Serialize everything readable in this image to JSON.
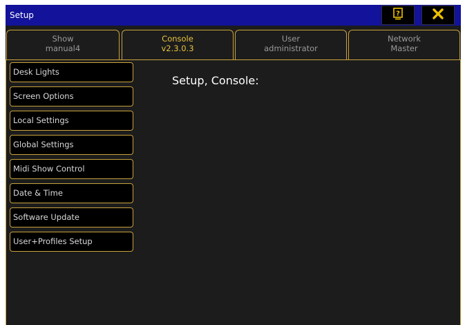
{
  "window": {
    "title": "Setup"
  },
  "titlebar_buttons": {
    "help_icon": "question-icon",
    "close_icon": "close-x-icon",
    "close_color": "#f0c000"
  },
  "tabs": [
    {
      "line1": "Show",
      "line2": "manual4",
      "active": false
    },
    {
      "line1": "Console",
      "line2": "v2.3.0.3",
      "active": true
    },
    {
      "line1": "User",
      "line2": "administrator",
      "active": false
    },
    {
      "line1": "Network",
      "line2": "Master",
      "active": false
    }
  ],
  "menu": {
    "items": [
      {
        "label": "Desk Lights"
      },
      {
        "label": "Screen Options"
      },
      {
        "label": "Local Settings"
      },
      {
        "label": "Global Settings"
      },
      {
        "label": "Midi Show Control"
      },
      {
        "label": "Date & Time"
      },
      {
        "label": "Software Update"
      },
      {
        "label": "User+Profiles Setup"
      }
    ]
  },
  "main": {
    "heading": "Setup, Console:"
  },
  "colors": {
    "titlebar": "#12129a",
    "accent": "#c9a33b",
    "active_tab_text": "#e7c33e",
    "background": "#1c1c1c"
  }
}
